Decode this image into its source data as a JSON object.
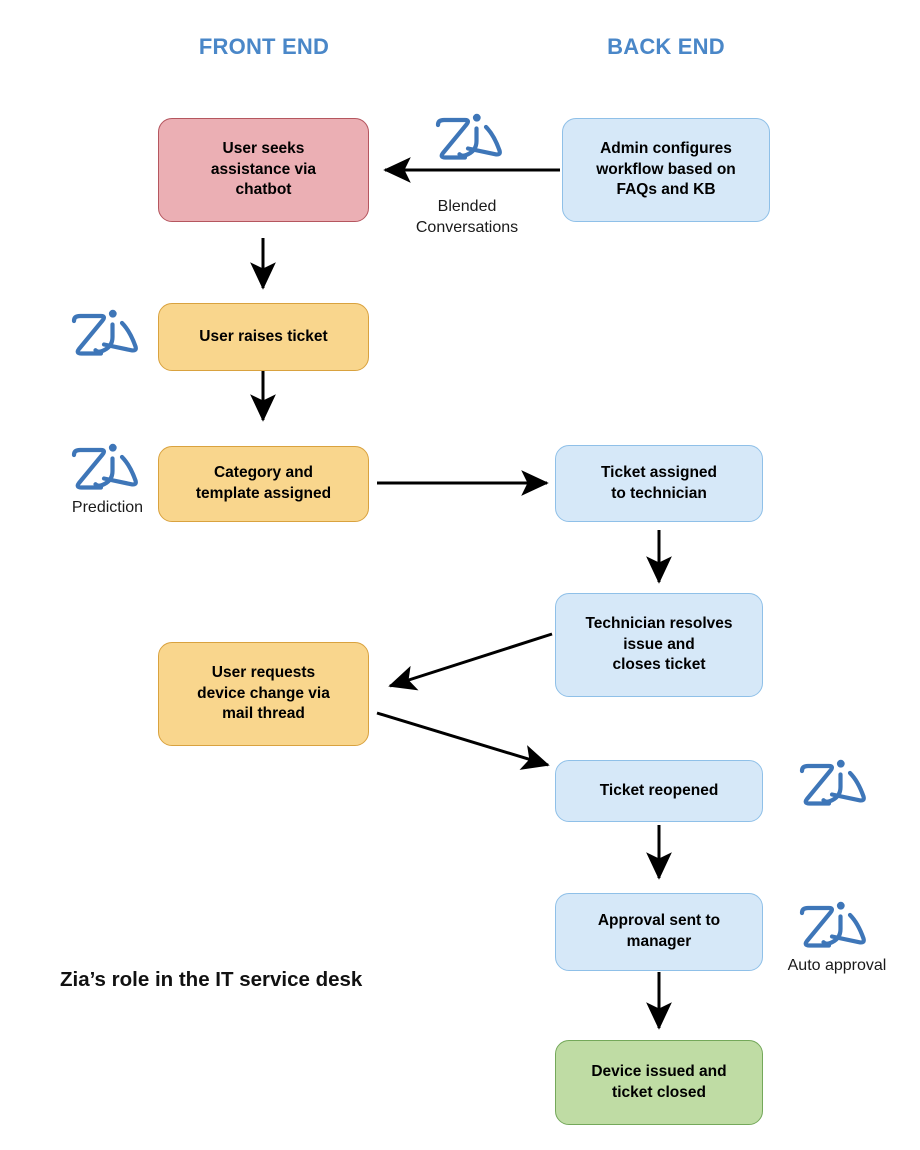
{
  "columns": {
    "front_end": "FRONT END",
    "back_end": "BACK END"
  },
  "nodes": {
    "user_seeks_assistance": "User seeks\nassistance via\nchatbot",
    "admin_configures_workflow": "Admin configures\nworkflow based on\nFAQs and KB",
    "user_raises_ticket": "User raises ticket",
    "category_template_assigned": "Category and\ntemplate assigned",
    "ticket_assigned_technician": "Ticket assigned\nto technician",
    "technician_resolves": "Technician resolves\nissue and\ncloses ticket",
    "user_requests_device": "User requests\ndevice  change via\nmail thread",
    "ticket_reopened": "Ticket reopened",
    "approval_sent_manager": "Approval sent to\nmanager",
    "device_issued_closed": "Device issued and\nticket closed"
  },
  "edge_labels": {
    "blended_conversations": "Blended\nConversations",
    "prediction": "Prediction",
    "auto_approval": "Auto approval"
  },
  "caption": "Zia’s role in the IT service desk",
  "icons": {
    "zia_logo": "zia-logo"
  },
  "colors": {
    "header_blue": "#4A87C8",
    "zia_blue": "#3E76B8",
    "pink_fill": "#EBAFB4",
    "pink_border": "#B5565F",
    "orange_fill": "#F9D68D",
    "orange_border": "#D9A23F",
    "blue_fill": "#D6E8F8",
    "blue_border": "#8FC0E8",
    "green_fill": "#BFDCA4",
    "green_border": "#74A85A",
    "arrow": "#000000",
    "background": "#FFFFFF"
  }
}
